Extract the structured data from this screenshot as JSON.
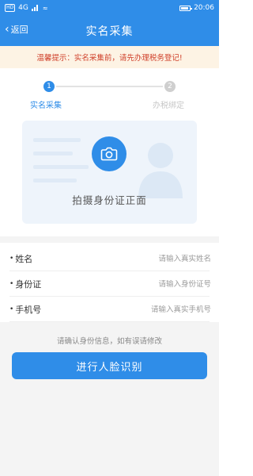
{
  "status_bar": {
    "sim_badge": "HD",
    "network": "4G",
    "time": "20:06"
  },
  "nav": {
    "back_label": "返回",
    "title": "实名采集"
  },
  "notice": {
    "text": "温馨提示：实名采集前，请先办理税务登记!"
  },
  "steps": [
    {
      "number": "1",
      "label": "实名采集",
      "active": true
    },
    {
      "number": "2",
      "label": "办税绑定",
      "active": false
    }
  ],
  "id_card": {
    "caption": "拍摄身份证正面",
    "icon": "camera-icon"
  },
  "form": {
    "fields": [
      {
        "label": "姓名",
        "placeholder": "请输入真实姓名",
        "value": ""
      },
      {
        "label": "身份证",
        "placeholder": "请输入身份证号",
        "value": ""
      },
      {
        "label": "手机号",
        "placeholder": "请输入真实手机号",
        "value": ""
      }
    ],
    "required_mark": "•"
  },
  "hint": "请确认身份信息，如有误请修改",
  "submit_button": "进行人脸识别",
  "colors": {
    "primary": "#2f8de8",
    "notice_text": "#d0402a",
    "notice_bg": "#fdf3e4"
  }
}
